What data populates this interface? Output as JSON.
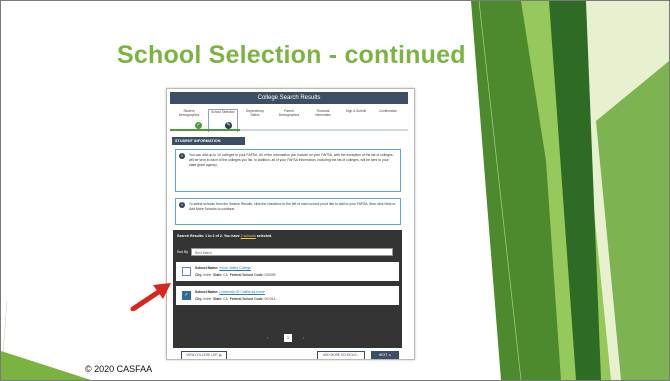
{
  "slide": {
    "title": "School Selection - continued",
    "footer": "© 2020 CASFAA"
  },
  "app": {
    "header_title": "College Search Results",
    "steps": [
      {
        "label": "Student Demographics"
      },
      {
        "label": "School Selection"
      },
      {
        "label": "Dependency Status"
      },
      {
        "label": "Parent Demographics"
      },
      {
        "label": "Financial Information"
      },
      {
        "label": "Sign & Submit"
      },
      {
        "label": "Confirmation"
      }
    ],
    "section_title": "STUDENT INFORMATION",
    "info_box_1": "You can add up to 10 colleges to your FAFSA. All of the information you include on your FAFSA, with the exception of the list of colleges, will be sent to each of the colleges you list. In addition, all of your FAFSA information, including the list of colleges, will be sent to your state grant agency.",
    "info_box_2": "To select schools from the Search Results, click the checkbox to the left of each school you'd like to add to your FAFSA, then click Next or Add More Schools to continue.",
    "results_title": "Search Results: 1 to 2 of 2. You have",
    "results_link": "2 schools",
    "results_suffix": "selected.",
    "sort_label": "Sort By",
    "sort_value": "Best Match",
    "schools": [
      {
        "name_label": "School Name:",
        "name": "Irvine Valley College",
        "city_label": "City:",
        "city": "Irvine",
        "state_label": "State:",
        "state": "CA",
        "code_label": "Federal School Code:",
        "code": "025395",
        "checked": false
      },
      {
        "name_label": "School Name:",
        "name": "University Of California-Irvine",
        "city_label": "City:",
        "city": "Irvine",
        "state_label": "State:",
        "state": "CA",
        "code_label": "Federal School Code:",
        "code": "001314",
        "checked": true
      }
    ],
    "page_current": "1",
    "view_list_label": "VIEW COLLEGE LIST",
    "add_more_label": "ADD MORE SCHOOLS",
    "next_label": "NEXT"
  },
  "colors": {
    "title_green": "#7cb442",
    "header_navy": "#3c4e63",
    "arrow_red": "#d8261f"
  }
}
